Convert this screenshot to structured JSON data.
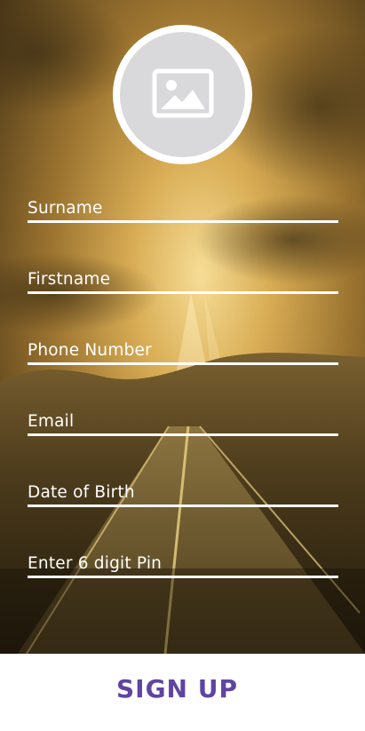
{
  "form": {
    "fields": [
      {
        "label": "Surname"
      },
      {
        "label": "Firstname"
      },
      {
        "label": "Phone Number"
      },
      {
        "label": "Email"
      },
      {
        "label": "Date of Birth"
      },
      {
        "label": "Enter 6 digit Pin"
      }
    ]
  },
  "avatar": {
    "icon": "image-placeholder-icon"
  },
  "footer": {
    "signup_label": "SIGN UP"
  },
  "colors": {
    "accent": "#5f44a3",
    "field_line": "#ffffff",
    "avatar_bg": "#d9d8da"
  }
}
